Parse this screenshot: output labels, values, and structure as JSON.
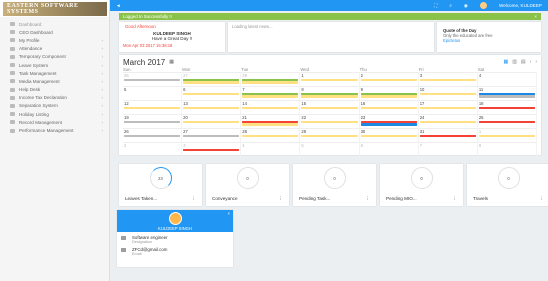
{
  "brand": {
    "text": "EASTERN SOFTWARE SYSTEMS"
  },
  "sidebar": {
    "items": [
      {
        "label": "Dashboard",
        "chev": ""
      },
      {
        "label": "CEO Dashboard",
        "chev": ""
      },
      {
        "label": "My Profile",
        "chev": "›"
      },
      {
        "label": "Attendance",
        "chev": "›"
      },
      {
        "label": "Temporary Component",
        "chev": "›"
      },
      {
        "label": "Leave System",
        "chev": "›"
      },
      {
        "label": "Task Management",
        "chev": "›"
      },
      {
        "label": "Media Management",
        "chev": "›"
      },
      {
        "label": "Help Desk",
        "chev": "›"
      },
      {
        "label": "Income Tax Declaration",
        "chev": "›"
      },
      {
        "label": "Separation System",
        "chev": "›"
      },
      {
        "label": "Holiday Listing",
        "chev": "›"
      },
      {
        "label": "Record Management",
        "chev": "›"
      },
      {
        "label": "Performance Management",
        "chev": "›"
      }
    ]
  },
  "topbar": {
    "back": "◄",
    "welcome": "Welcome, KULDEEP"
  },
  "notice": {
    "text": "Logged In Successfully !!",
    "close": "×"
  },
  "welcome_card": {
    "heading": "Good Afternoon",
    "name": "KULDEEP SINGH",
    "greeting": "Have a Great Day !!",
    "datetime": "Mon Apr 03 2017 15:36:18"
  },
  "loading": {
    "text": "Loading latest news..."
  },
  "quote": {
    "title": "Quote of the Day",
    "body": "Only the educated are free",
    "author": "Epictetus"
  },
  "calendar": {
    "title": "March 2017",
    "days": [
      "Sun",
      "Mon",
      "Tue",
      "Wed",
      "Thu",
      "Fri",
      "Sat"
    ],
    "weeks": [
      [
        "26",
        "27",
        "28",
        "1",
        "2",
        "3",
        "4"
      ],
      [
        "5",
        "6",
        "7",
        "8",
        "9",
        "10",
        "11"
      ],
      [
        "12",
        "13",
        "14",
        "15",
        "16",
        "17",
        "18"
      ],
      [
        "19",
        "20",
        "21",
        "22",
        "23",
        "24",
        "25"
      ],
      [
        "26",
        "27",
        "28",
        "29",
        "30",
        "31",
        "1"
      ],
      [
        "2",
        "3",
        "4",
        "5",
        "6",
        "7",
        "8"
      ]
    ],
    "colors": {
      "green": "#8bc34a",
      "yellow": "#ffe082",
      "grey": "#bdbdbd",
      "red": "#f44336",
      "blue": "#1e88e5"
    }
  },
  "stats": [
    {
      "value": "23",
      "label": "Leaves Taken..."
    },
    {
      "value": "0",
      "label": "Conveyance"
    },
    {
      "value": "0",
      "label": "Pending Task..."
    },
    {
      "value": "0",
      "label": "Pending MIO..."
    },
    {
      "value": "0",
      "label": "Travels"
    }
  ],
  "profile": {
    "name": "KULDEEP SINGH",
    "designation": "Software engineer",
    "designation_caption": "Designation",
    "email": "ZFCd@gmail.com",
    "email_caption": "Email"
  }
}
